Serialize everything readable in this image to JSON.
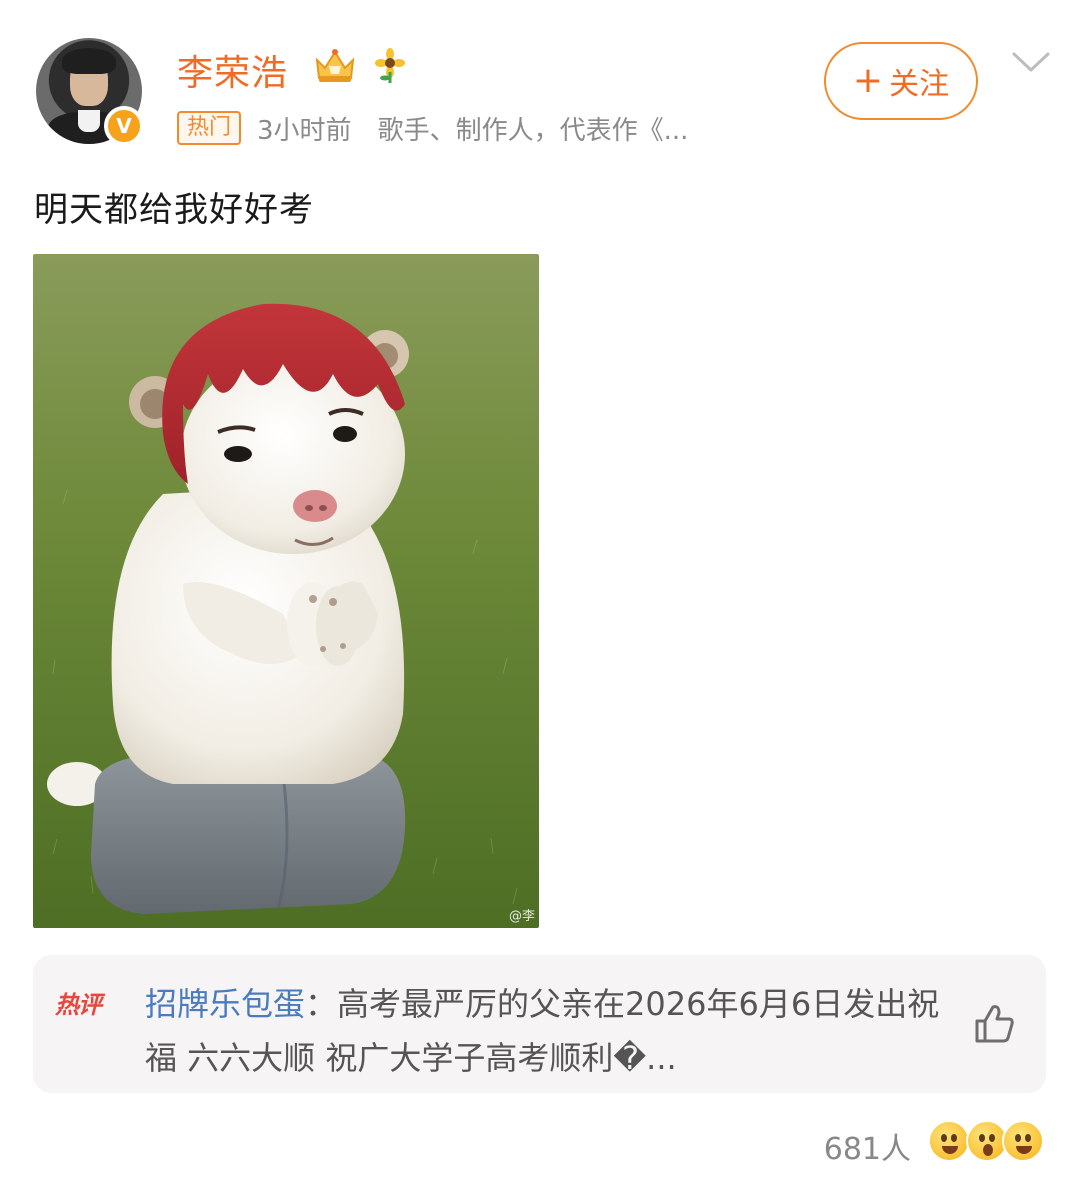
{
  "user": {
    "name": "李荣浩",
    "badge_letter": "V"
  },
  "meta": {
    "hot_tag": "热门",
    "time": "3小时前",
    "description": "歌手、制作人，代表作《..."
  },
  "follow": {
    "plus": "+",
    "label": "关注"
  },
  "post": {
    "text": "明天都给我好好考",
    "watermark": "@李"
  },
  "hot_comment": {
    "tag": "热评",
    "author": "招牌乐包蛋",
    "separator": "：",
    "text": "高考最严厉的父亲在2026年6月6日发出祝福 六六大顺 祝广大学子高考顺利�..."
  },
  "footer": {
    "reaction_count": "681人"
  },
  "colors": {
    "accent": "#f26b24",
    "link": "#4a7bbf"
  }
}
